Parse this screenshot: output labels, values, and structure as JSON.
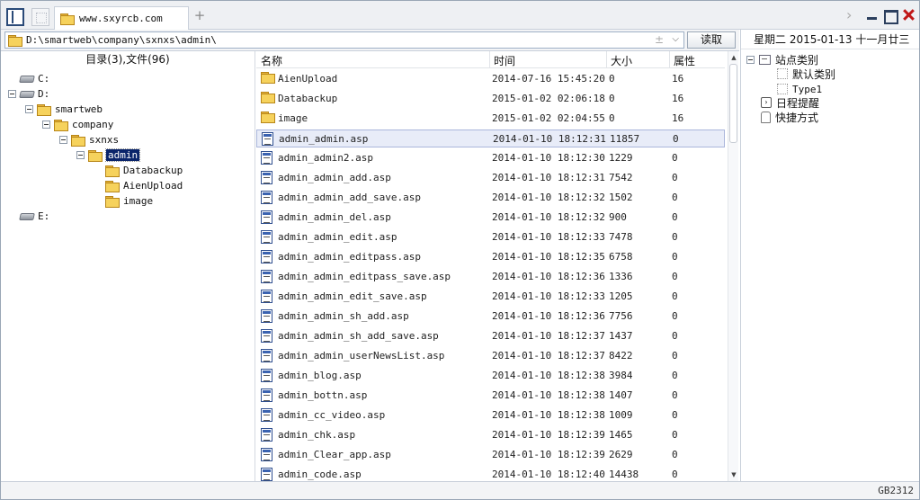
{
  "tab": {
    "label": "www.sxyrcb.com"
  },
  "address": {
    "value": "D:\\smartweb\\company\\sxnxs\\admin\\",
    "plus_minus": "±",
    "dropdown": "⌵",
    "read_label": "读取"
  },
  "tree": {
    "header": "目录(3),文件(96)",
    "nodes": [
      {
        "label": "C:",
        "type": "drive",
        "level": 0,
        "expand": false
      },
      {
        "label": "D:",
        "type": "drive",
        "level": 0,
        "expand": true
      },
      {
        "label": "smartweb",
        "type": "folder",
        "level": 1,
        "expand": true
      },
      {
        "label": "company",
        "type": "folder",
        "level": 2,
        "expand": true
      },
      {
        "label": "sxnxs",
        "type": "folder",
        "level": 3,
        "expand": true
      },
      {
        "label": "admin",
        "type": "folder",
        "level": 4,
        "expand": true,
        "selected": true
      },
      {
        "label": "Databackup",
        "type": "folder",
        "level": 5,
        "expand": false
      },
      {
        "label": "AienUpload",
        "type": "folder",
        "level": 5,
        "expand": false
      },
      {
        "label": "image",
        "type": "folder",
        "level": 5,
        "expand": false
      },
      {
        "label": "E:",
        "type": "drive",
        "level": 0,
        "expand": false
      }
    ]
  },
  "list": {
    "columns": {
      "name": "名称",
      "time": "时间",
      "size": "大小",
      "attr": "属性"
    },
    "rows": [
      {
        "type": "folder",
        "name": "AienUpload",
        "time": "2014-07-16 15:45:20",
        "size": "0",
        "attr": "16"
      },
      {
        "type": "folder",
        "name": "Databackup",
        "time": "2015-01-02 02:06:18",
        "size": "0",
        "attr": "16"
      },
      {
        "type": "folder",
        "name": "image",
        "time": "2015-01-02 02:04:55",
        "size": "0",
        "attr": "16"
      },
      {
        "type": "file",
        "name": "admin_admin.asp",
        "time": "2014-01-10 18:12:31",
        "size": "11857",
        "attr": "0",
        "selected": true
      },
      {
        "type": "file",
        "name": "admin_admin2.asp",
        "time": "2014-01-10 18:12:30",
        "size": "1229",
        "attr": "0"
      },
      {
        "type": "file",
        "name": "admin_admin_add.asp",
        "time": "2014-01-10 18:12:31",
        "size": "7542",
        "attr": "0"
      },
      {
        "type": "file",
        "name": "admin_admin_add_save.asp",
        "time": "2014-01-10 18:12:32",
        "size": "1502",
        "attr": "0"
      },
      {
        "type": "file",
        "name": "admin_admin_del.asp",
        "time": "2014-01-10 18:12:32",
        "size": "900",
        "attr": "0"
      },
      {
        "type": "file",
        "name": "admin_admin_edit.asp",
        "time": "2014-01-10 18:12:33",
        "size": "7478",
        "attr": "0"
      },
      {
        "type": "file",
        "name": "admin_admin_editpass.asp",
        "time": "2014-01-10 18:12:35",
        "size": "6758",
        "attr": "0"
      },
      {
        "type": "file",
        "name": "admin_admin_editpass_save.asp",
        "time": "2014-01-10 18:12:36",
        "size": "1336",
        "attr": "0"
      },
      {
        "type": "file",
        "name": "admin_admin_edit_save.asp",
        "time": "2014-01-10 18:12:33",
        "size": "1205",
        "attr": "0"
      },
      {
        "type": "file",
        "name": "admin_admin_sh_add.asp",
        "time": "2014-01-10 18:12:36",
        "size": "7756",
        "attr": "0"
      },
      {
        "type": "file",
        "name": "admin_admin_sh_add_save.asp",
        "time": "2014-01-10 18:12:37",
        "size": "1437",
        "attr": "0"
      },
      {
        "type": "file",
        "name": "admin_admin_userNewsList.asp",
        "time": "2014-01-10 18:12:37",
        "size": "8422",
        "attr": "0"
      },
      {
        "type": "file",
        "name": "admin_blog.asp",
        "time": "2014-01-10 18:12:38",
        "size": "3984",
        "attr": "0"
      },
      {
        "type": "file",
        "name": "admin_bottn.asp",
        "time": "2014-01-10 18:12:38",
        "size": "1407",
        "attr": "0"
      },
      {
        "type": "file",
        "name": "admin_cc_video.asp",
        "time": "2014-01-10 18:12:38",
        "size": "1009",
        "attr": "0"
      },
      {
        "type": "file",
        "name": "admin_chk.asp",
        "time": "2014-01-10 18:12:39",
        "size": "1465",
        "attr": "0"
      },
      {
        "type": "file",
        "name": "admin_Clear_app.asp",
        "time": "2014-01-10 18:12:39",
        "size": "2629",
        "attr": "0"
      },
      {
        "type": "file",
        "name": "admin_code.asp",
        "time": "2014-01-10 18:12:40",
        "size": "14438",
        "attr": "0"
      }
    ]
  },
  "right": {
    "date": "星期二 2015-01-13 十一月廿三",
    "site_category": "站点类别",
    "default_category": "默认类别",
    "type1": "Type1",
    "schedule": "日程提醒",
    "shortcut": "快捷方式"
  },
  "status": {
    "encoding": "GB2312"
  }
}
